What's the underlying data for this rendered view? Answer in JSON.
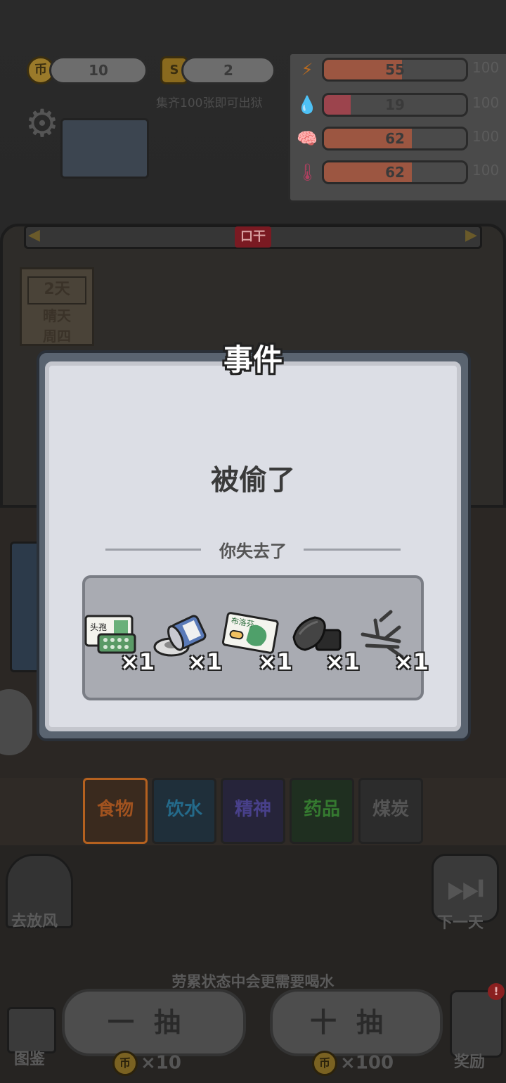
{
  "hud": {
    "coins": "10",
    "cards": "2",
    "card_hint": "集齐100张即可出狱",
    "coin_glyph": "币",
    "card_glyph": "S"
  },
  "stats": [
    {
      "icon": "lightning-icon",
      "glyph": "⚡",
      "value": "55",
      "max": "100",
      "fraction": 0.55,
      "color": "#e0603a"
    },
    {
      "icon": "water-drop-icon",
      "glyph": "💧",
      "value": "19",
      "max": "100",
      "fraction": 0.19,
      "color": "#e04050"
    },
    {
      "icon": "brain-icon",
      "glyph": "🧠",
      "value": "62",
      "max": "100",
      "fraction": 0.62,
      "color": "#e0603a"
    },
    {
      "icon": "thermometer-icon",
      "glyph": "🌡",
      "value": "62",
      "max": "100",
      "fraction": 0.62,
      "color": "#e0603a"
    }
  ],
  "status_badge": "口干",
  "calendar": {
    "day": "2天",
    "weather": "晴天",
    "weekday": "周四"
  },
  "categories": [
    {
      "label": "食物",
      "color": "#c7612a"
    },
    {
      "label": "饮水",
      "color": "#2a7fa8"
    },
    {
      "label": "精神",
      "color": "#5a4ea8"
    },
    {
      "label": "药品",
      "color": "#3f8a3a"
    },
    {
      "label": "煤炭",
      "color": "#6a6a6a"
    }
  ],
  "actions": {
    "go_out": "去放风",
    "next_day": "下一天",
    "tip": "劳累状态中会更需要喝水",
    "handbook": "图鉴",
    "draw_one": "一抽",
    "draw_ten": "十抽",
    "draw_one_cost": "×10",
    "draw_ten_cost": "×100",
    "reward": "奖励"
  },
  "modal": {
    "title": "事件",
    "event": "被偷了",
    "lost_label": "你失去了",
    "items": [
      {
        "name": "pill-pack-icon",
        "qty": "×1",
        "label": "头孢"
      },
      {
        "name": "ointment-tin-icon",
        "qty": "×1",
        "label": "药膏"
      },
      {
        "name": "medicine-box-icon",
        "qty": "×1",
        "label": "布洛芬"
      },
      {
        "name": "coal-icon",
        "qty": "×1",
        "label": ""
      },
      {
        "name": "branches-icon",
        "qty": "×1",
        "label": ""
      }
    ]
  }
}
